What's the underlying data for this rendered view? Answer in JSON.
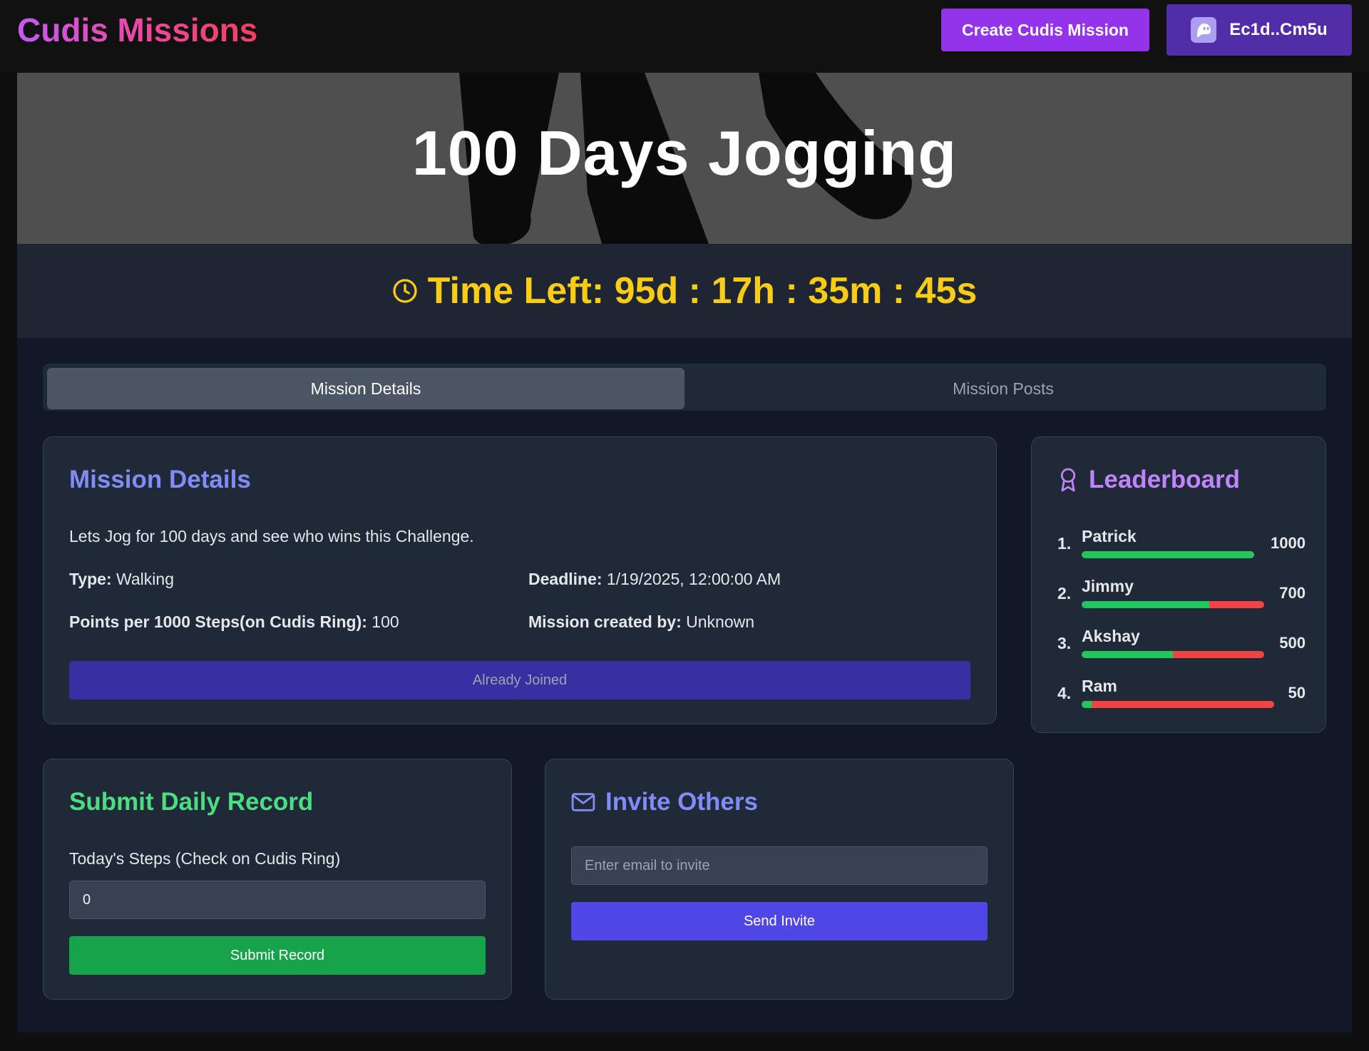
{
  "header": {
    "brand": "Cudis Missions",
    "create_button": "Create Cudis Mission",
    "wallet": {
      "address": "Ec1d..Cm5u",
      "icon": "phantom-ghost-icon"
    }
  },
  "hero": {
    "title": "100 Days Jogging"
  },
  "timer": {
    "text": "Time Left: 95d : 17h : 35m : 45s",
    "icon": "clock-icon",
    "color": "#facc15"
  },
  "tabs": [
    {
      "label": "Mission Details",
      "active": true
    },
    {
      "label": "Mission Posts",
      "active": false
    }
  ],
  "details": {
    "title": "Mission Details",
    "description": "Lets Jog for 100 days and see who wins this Challenge.",
    "type_label": "Type:",
    "type_value": "Walking",
    "deadline_label": "Deadline:",
    "deadline_value": "1/19/2025, 12:00:00 AM",
    "points_label": "Points per 1000 Steps(on Cudis Ring):",
    "points_value": "100",
    "creator_label": "Mission created by:",
    "creator_value": "Unknown",
    "join_button": "Already Joined"
  },
  "leaderboard": {
    "title": "Leaderboard",
    "icon": "award-ribbon-icon",
    "entries": [
      {
        "rank": "1.",
        "name": "Patrick",
        "score": "1000",
        "progress": 1.0
      },
      {
        "rank": "2.",
        "name": "Jimmy",
        "score": "700",
        "progress": 0.7
      },
      {
        "rank": "3.",
        "name": "Akshay",
        "score": "500",
        "progress": 0.5
      },
      {
        "rank": "4.",
        "name": "Ram",
        "score": "50",
        "progress": 0.05
      }
    ]
  },
  "submit": {
    "title": "Submit Daily Record",
    "label": "Today's Steps (Check on Cudis Ring)",
    "value": "0",
    "button": "Submit Record"
  },
  "invite": {
    "title": "Invite Others",
    "icon": "mail-icon",
    "placeholder": "Enter email to invite",
    "button": "Send Invite"
  }
}
